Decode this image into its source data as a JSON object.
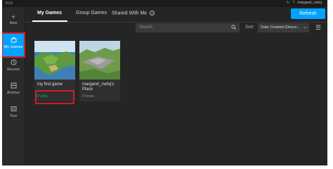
{
  "window": {
    "file_label": "FILE",
    "username": "margaret_cwhq"
  },
  "sidebar": {
    "items": [
      {
        "label": "New",
        "icon": "plus-icon"
      },
      {
        "label": "My Games",
        "icon": "games-icon"
      },
      {
        "label": "Recent",
        "icon": "clock-icon"
      },
      {
        "label": "Archive",
        "icon": "archive-icon"
      },
      {
        "label": "Tour",
        "icon": "tour-icon"
      }
    ]
  },
  "tabs": [
    "My Games",
    "Group Games",
    "Shared With Me"
  ],
  "refresh_label": "Refresh",
  "search": {
    "placeholder": "Search"
  },
  "sort": {
    "label": "Sort:",
    "value": "Date Created (Desce..."
  },
  "games": [
    {
      "title": "my first game",
      "status": "Public",
      "status_color": "#02b757"
    },
    {
      "title": "margaret_cwhq's Place",
      "status": "Private",
      "status_color": "#8a8a8a"
    }
  ],
  "colors": {
    "accent": "#00a2ff",
    "highlight": "#d01d2a"
  }
}
